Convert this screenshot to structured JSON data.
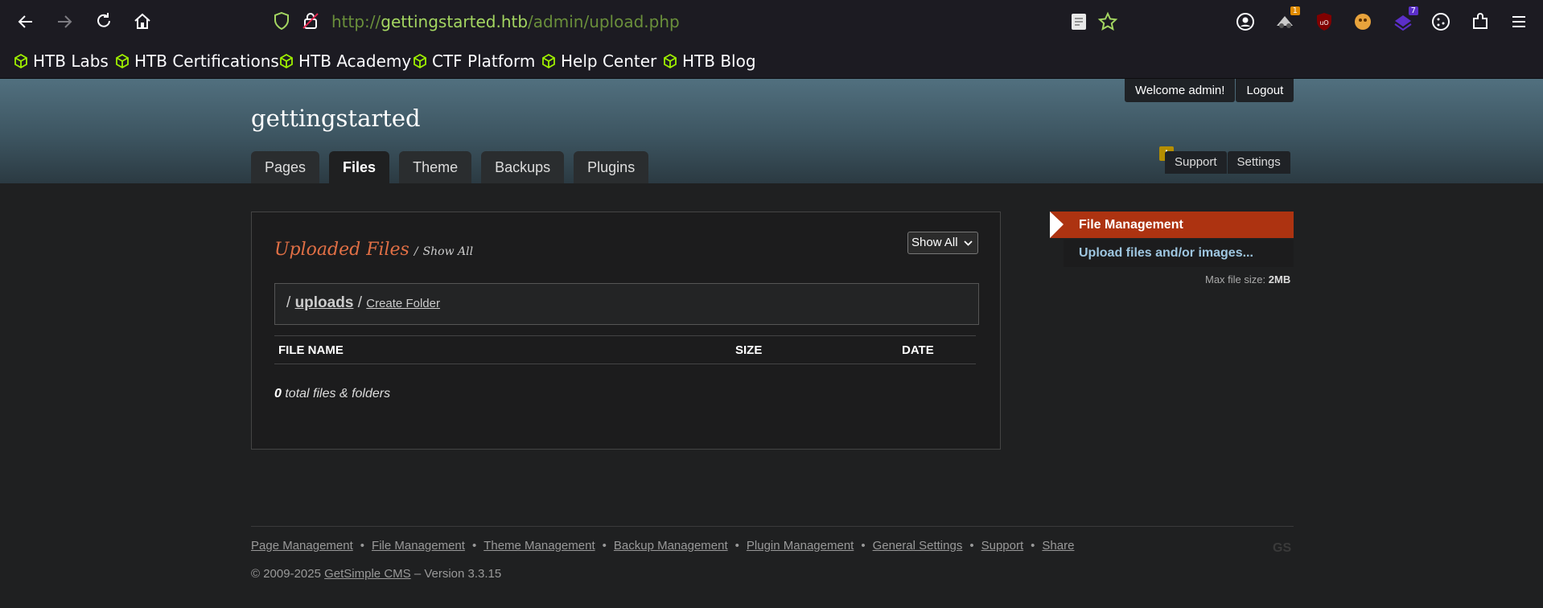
{
  "browser": {
    "url_scheme": "http://",
    "url_domain": "gettingstarted.htb",
    "url_path": "/admin/upload.php",
    "extension_badges": {
      "ext2": "1",
      "ext5": "7"
    },
    "bookmarks": [
      "HTB Labs",
      "HTB Certifications",
      "HTB Academy",
      "CTF Platform",
      "Help Center",
      "HTB Blog"
    ]
  },
  "header": {
    "site_title": "gettingstarted",
    "welcome": "Welcome admin!",
    "logout": "Logout",
    "tabs": [
      "Pages",
      "Files",
      "Theme",
      "Backups",
      "Plugins"
    ],
    "active_tab": "Files",
    "support": "Support",
    "settings": "Settings",
    "alert": "!"
  },
  "main": {
    "title": "Uploaded Files",
    "title_sep": "/",
    "show_all_link": "Show All",
    "filter_selected": "Show All",
    "path_prefix": "/",
    "folder": "uploads",
    "path_sep": "/",
    "create_folder": "Create Folder",
    "columns": [
      "FILE NAME",
      "SIZE",
      "DATE"
    ],
    "total_count": "0",
    "total_label": "total files & folders"
  },
  "sidebar": {
    "active_item": "File Management",
    "upload_item": "Upload files and/or images...",
    "max_size_label": "Max file size:",
    "max_size_value": "2MB"
  },
  "footer": {
    "links": [
      "Page Management",
      "File Management",
      "Theme Management",
      "Backup Management",
      "Plugin Management",
      "General Settings",
      "Support",
      "Share"
    ],
    "copyright_prefix": "© 2009-2025",
    "cms_link": "GetSimple CMS",
    "version": "– Version 3.3.15",
    "logo": "GS"
  },
  "colors": {
    "accent": "#ad3311",
    "title_orange": "#e06f45",
    "link_blue": "#9ec6e0",
    "url_green": "#a4d661"
  },
  "icons": [
    "back-icon",
    "forward-icon",
    "reload-icon",
    "home-icon",
    "tracking-shield-icon",
    "insecure-lock-icon",
    "reader-icon",
    "bookmark-star-icon",
    "account-icon",
    "extensions-icon",
    "menu-icon",
    "cube-icon"
  ]
}
